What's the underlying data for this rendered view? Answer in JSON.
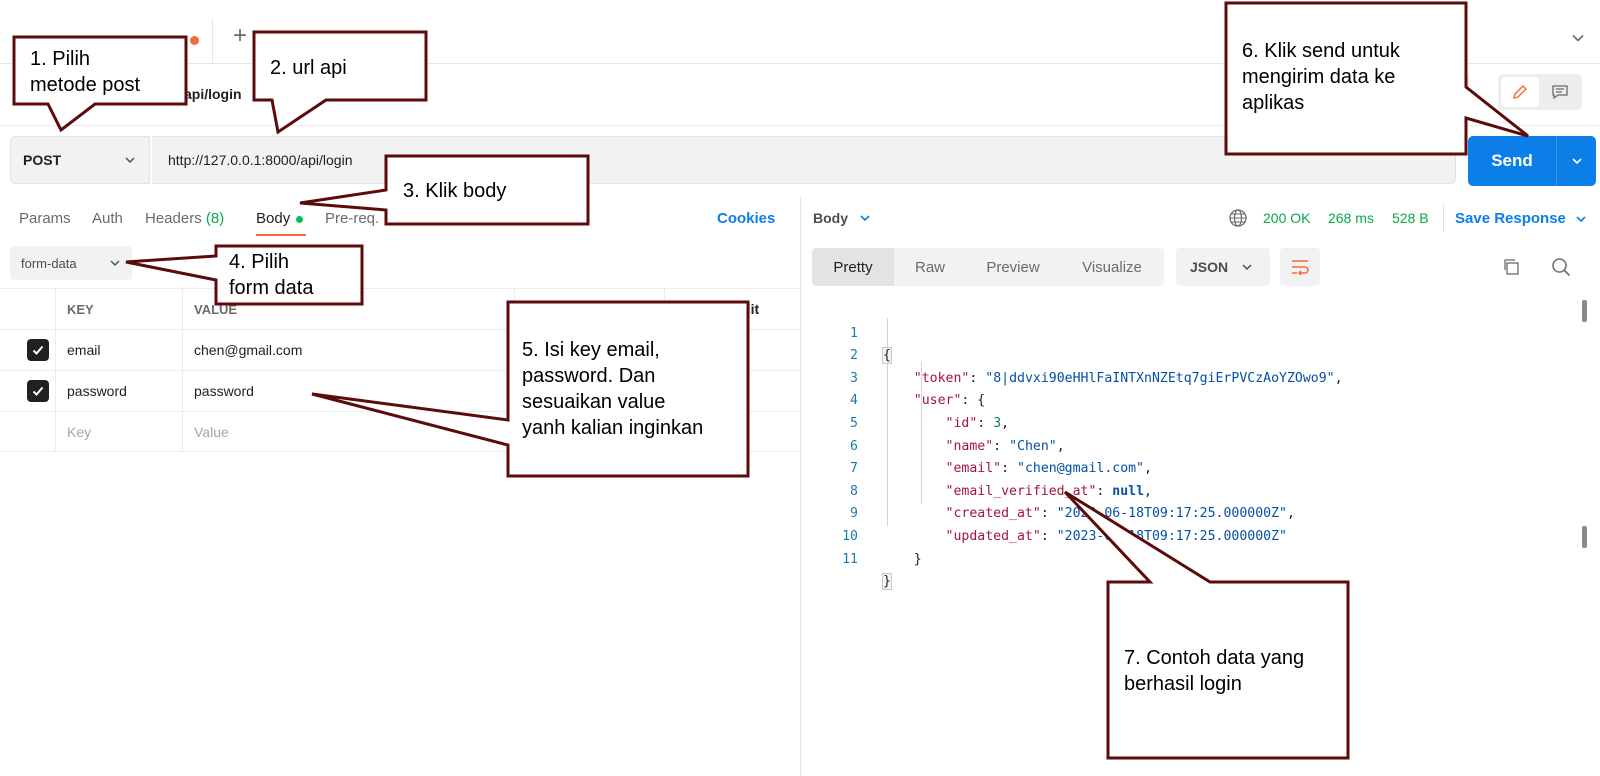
{
  "tabs": {
    "new_tab": "+"
  },
  "request": {
    "name": "api/login",
    "method": "POST",
    "url": "http://127.0.0.1:8000/api/login",
    "send_label": "Send"
  },
  "request_tabs": {
    "params": "Params",
    "auth": "Auth",
    "headers": "Headers",
    "headers_count": "(8)",
    "body": "Body",
    "prereq": "Pre-req.",
    "cookies": "Cookies"
  },
  "body_mode": "form-data",
  "kv_table": {
    "headers": {
      "key": "KEY",
      "value": "VALUE",
      "bulk_edit": "k Edit"
    },
    "rows": [
      {
        "key": "email",
        "value": "chen@gmail.com",
        "checked": true
      },
      {
        "key": "password",
        "value": "password",
        "checked": true
      }
    ],
    "placeholder": {
      "key": "Key",
      "value": "Value"
    }
  },
  "response": {
    "body_label": "Body",
    "status": "200 OK",
    "time": "268 ms",
    "size": "528 B",
    "save_label": "Save Response",
    "view_tabs": [
      "Pretty",
      "Raw",
      "Preview",
      "Visualize"
    ],
    "format": "JSON",
    "line_numbers": [
      "1",
      "2",
      "3",
      "4",
      "5",
      "6",
      "7",
      "8",
      "9",
      "10",
      "11"
    ],
    "json": {
      "token": "8|ddvxi90eHHlFaINTXnNZEtq7giErPVCzAoYZOwo9",
      "id": "3",
      "name": "Chen",
      "email": "chen@gmail.com",
      "email_verified_at": "null",
      "created_at": "2023-06-18T09:17:25.000000Z",
      "updated_at": "2023-06-18T09:17:25.000000Z"
    }
  },
  "annotations": {
    "c1": [
      "1. Pilih",
      "metode post"
    ],
    "c2": [
      "2. url api"
    ],
    "c3": [
      "3. Klik body"
    ],
    "c4": [
      "4. Pilih",
      "form data"
    ],
    "c5": [
      "5. Isi key email,",
      "password. Dan",
      "sesuaikan value",
      "yanh kalian inginkan"
    ],
    "c6": [
      "6. Klik send untuk",
      "mengirim data ke",
      "aplikas"
    ],
    "c7": [
      "7. Contoh data yang",
      "berhasil login"
    ]
  },
  "colors": {
    "accent_blue": "#0c7ee8",
    "accent_orange": "#f26b3a",
    "success_green": "#0aa84a",
    "callout_border": "#5c0b0b"
  }
}
